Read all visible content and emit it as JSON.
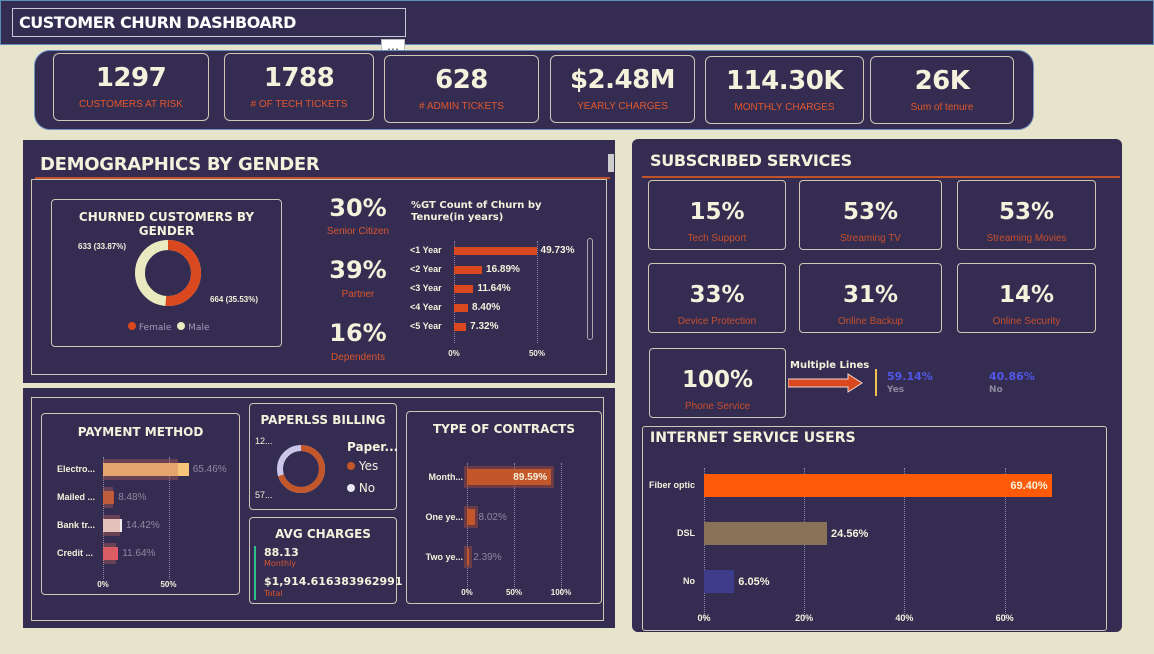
{
  "title": "CUSTOMER CHURN DASHBOARD",
  "more_menu": "⋯",
  "kpis": [
    {
      "value": "1297",
      "label": "CUSTOMERS AT RISK"
    },
    {
      "value": "1788",
      "label": "# OF TECH TICKETS"
    },
    {
      "value": "628",
      "label": "# ADMIN TICKETS"
    },
    {
      "value": "$2.48M",
      "label": "YEARLY CHARGES"
    },
    {
      "value": "114.30K",
      "label": "MONTHLY CHARGES"
    },
    {
      "value": "26K",
      "label": "Sum of tenure"
    }
  ],
  "demographics": {
    "title": "DEMOGRAPHICS BY GENDER",
    "gender_card": {
      "title": "CHURNED CUSTOMERS BY GENDER",
      "male_label": "633 (33.87%)",
      "female_label": "664 (35.53%)",
      "female_share": 0.512,
      "legend": [
        "Female",
        "Male"
      ]
    },
    "stats": [
      {
        "value": "30%",
        "label": "Senior Citizen"
      },
      {
        "value": "39%",
        "label": "Partner"
      },
      {
        "value": "16%",
        "label": "Dependents"
      }
    ],
    "tenure_chart": {
      "title": "%GT Count of Churn by Tenure(in years)",
      "categories": [
        "<1 Year",
        "<2 Year",
        "<3 Year",
        "<4 Year",
        "<5 Year"
      ],
      "labels": [
        "49.73%",
        "16.89%",
        "11.64%",
        "8.40%",
        "7.32%"
      ],
      "axis": [
        "0%",
        "50%"
      ]
    }
  },
  "payment": {
    "title": "PAYMENT METHOD",
    "categories": [
      "Electro...",
      "Mailed ...",
      "Bank tr...",
      "Credit ..."
    ],
    "labels": [
      "65.46%",
      "8.48%",
      "14.42%",
      "11.64%"
    ],
    "axis": [
      "0%",
      "50%"
    ]
  },
  "paperless": {
    "title": "PAPERLSS BILLING",
    "top_label": "12...",
    "bottom_label": "57...",
    "legend_title": "Paper...",
    "legend": [
      "Yes",
      "No"
    ]
  },
  "avg_charges": {
    "title": "AVG CHARGES",
    "monthly_value": "88.13",
    "monthly_label": "Monthly",
    "total_value": "$1,914.616383962991",
    "total_label": "Total"
  },
  "contracts": {
    "title": "TYPE OF CONTRACTS",
    "categories": [
      "Month...",
      "One ye...",
      "Two ye..."
    ],
    "labels": [
      "89.59%",
      "8.02%",
      "2.39%"
    ],
    "axis": [
      "0%",
      "50%",
      "100%"
    ]
  },
  "services": {
    "title": "SUBSCRIBED SERVICES",
    "cards": [
      {
        "value": "15%",
        "label": "Tech Support"
      },
      {
        "value": "53%",
        "label": "Streaming TV"
      },
      {
        "value": "53%",
        "label": "Streaming Movies"
      },
      {
        "value": "33%",
        "label": "Device Protection"
      },
      {
        "value": "31%",
        "label": "Online Backup"
      },
      {
        "value": "14%",
        "label": "Online Security"
      }
    ],
    "phone": {
      "value": "100%",
      "label": "Phone Service"
    },
    "multiple_lines": {
      "title": "Multiple Lines",
      "yes_value": "59.14%",
      "yes_label": "Yes",
      "no_value": "40.86%",
      "no_label": "No"
    }
  },
  "internet": {
    "title": "INTERNET SERVICE USERS",
    "categories": [
      "Fiber optic",
      "DSL",
      "No"
    ],
    "labels": [
      "69.40%",
      "24.56%",
      "6.05%"
    ],
    "axis": [
      "0%",
      "20%",
      "40%",
      "60%"
    ]
  },
  "chart_data": [
    {
      "type": "bar",
      "title": "%GT Count of Churn by Tenure(in years)",
      "categories": [
        "<1 Year",
        "<2 Year",
        "<3 Year",
        "<4 Year",
        "<5 Year"
      ],
      "values": [
        49.73,
        16.89,
        11.64,
        8.4,
        7.32
      ],
      "xlim": [
        0,
        60
      ]
    },
    {
      "type": "pie",
      "title": "CHURNED CUSTOMERS BY GENDER",
      "categories": [
        "Female",
        "Male"
      ],
      "values": [
        664,
        633
      ]
    },
    {
      "type": "bar",
      "title": "PAYMENT METHOD",
      "categories": [
        "Electro...",
        "Mailed ...",
        "Bank tr...",
        "Credit ..."
      ],
      "values": [
        65.46,
        8.48,
        14.42,
        11.64
      ],
      "xlim": [
        0,
        100
      ]
    },
    {
      "type": "pie",
      "title": "PAPERLSS BILLING",
      "categories": [
        "Yes",
        "No"
      ],
      "values": [
        70,
        30
      ]
    },
    {
      "type": "bar",
      "title": "TYPE OF CONTRACTS",
      "categories": [
        "Month...",
        "One ye...",
        "Two ye..."
      ],
      "values": [
        89.59,
        8.02,
        2.39
      ],
      "xlim": [
        0,
        100
      ]
    },
    {
      "type": "bar",
      "title": "INTERNET SERVICE USERS",
      "categories": [
        "Fiber optic",
        "DSL",
        "No"
      ],
      "values": [
        69.4,
        24.56,
        6.05
      ],
      "xlim": [
        0,
        80
      ]
    }
  ],
  "colors": {
    "bg": "#e7e4cc",
    "panel": "#352c52",
    "accent": "#e2572b",
    "fiber": "#ff5a0a",
    "dsl": "#8a7257",
    "no": "#3d3d8c",
    "gold": "#f5c57a"
  }
}
